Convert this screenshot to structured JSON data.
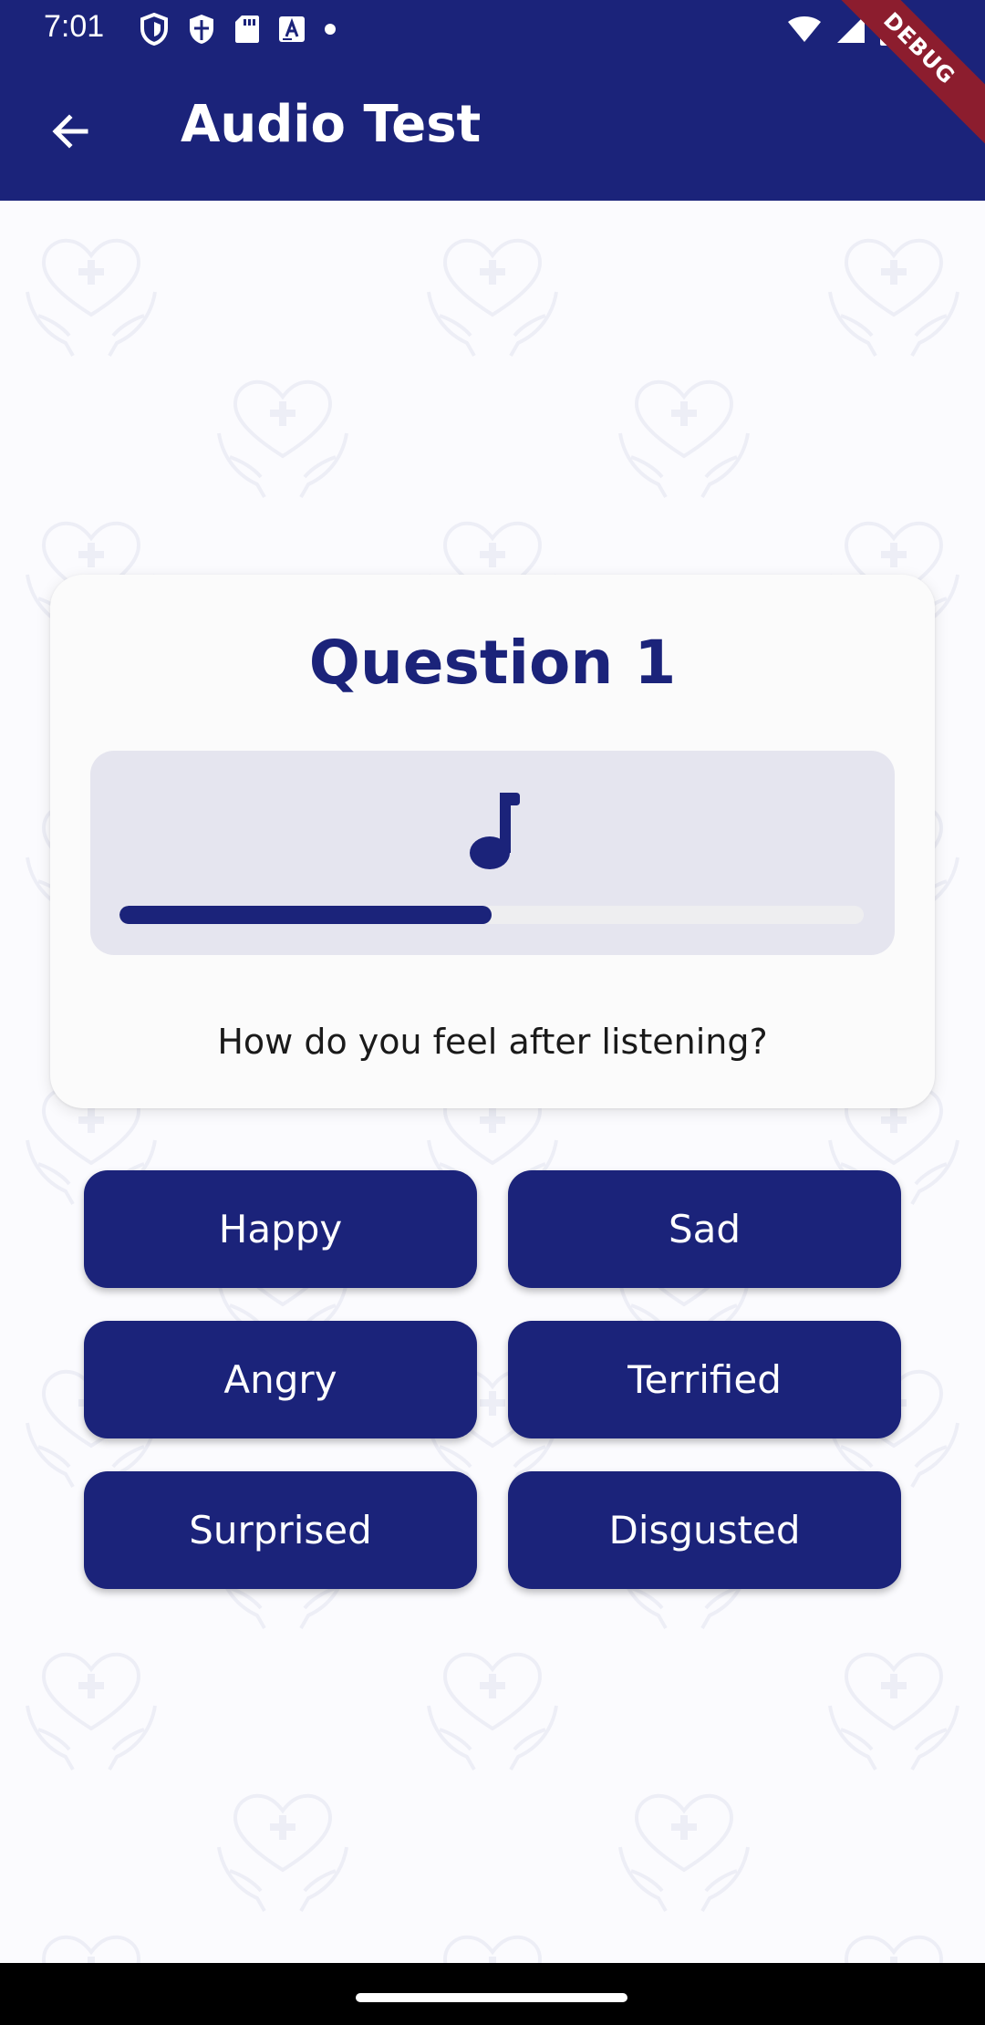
{
  "status_bar": {
    "time": "7:01",
    "left_icons": [
      "shield-icon",
      "security-shield-icon",
      "sd-card-icon",
      "font-a-icon",
      "dot-icon"
    ],
    "right_icons": [
      "wifi-icon",
      "signal-icon",
      "battery-icon"
    ]
  },
  "app_bar": {
    "title": "Audio Test",
    "back_icon": "arrow-back-icon",
    "debug_label": "DEBUG"
  },
  "question": {
    "title": "Question 1",
    "prompt": "How do you feel after listening?",
    "audio_icon": "music-note-icon",
    "progress": 0.5
  },
  "answers": [
    "Happy",
    "Sad",
    "Angry",
    "Terrified",
    "Surprised",
    "Disgusted"
  ],
  "colors": {
    "primary": "#1b237a",
    "background": "#fbfbfe",
    "panel": "#e5e5ef",
    "debug_banner": "#8c1d2e"
  }
}
